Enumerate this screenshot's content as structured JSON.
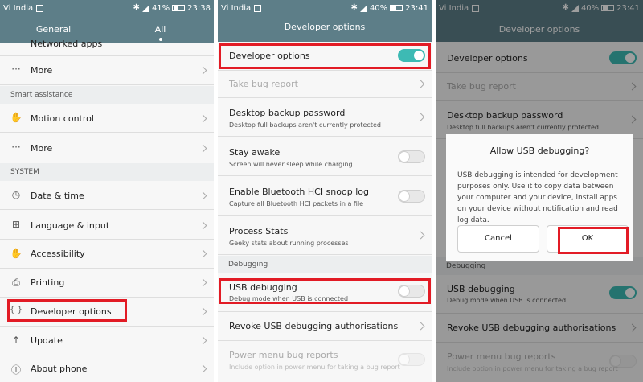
{
  "panel1": {
    "status": {
      "carrier": "Vi India",
      "battery": "41%",
      "time": "23:38"
    },
    "tabs": [
      {
        "label": "General"
      },
      {
        "label": "All"
      }
    ],
    "partial_row": "Networked apps",
    "rows_a": [
      {
        "label": "More"
      }
    ],
    "section_smart": "Smart assistance",
    "rows_b": [
      {
        "label": "Motion control",
        "icon": "✋"
      },
      {
        "label": "More",
        "icon": "···"
      }
    ],
    "section_system": "SYSTEM",
    "rows_c": [
      {
        "label": "Date & time",
        "icon": "◷"
      },
      {
        "label": "Language & input",
        "icon": "⊞"
      },
      {
        "label": "Accessibility",
        "icon": "✋"
      },
      {
        "label": "Printing",
        "icon": "⎙"
      },
      {
        "label": "Developer options",
        "icon": "{ }"
      },
      {
        "label": "Update",
        "icon": "↑"
      },
      {
        "label": "About phone",
        "icon": "ⓘ"
      }
    ]
  },
  "panel2": {
    "status": {
      "carrier": "Vi India",
      "battery": "40%",
      "time": "23:41"
    },
    "title": "Developer options",
    "rows": [
      {
        "label": "Developer options",
        "toggle": "on"
      },
      {
        "label": "Take bug report",
        "disabled": true
      },
      {
        "label": "Desktop backup password",
        "sub": "Desktop full backups aren't currently protected"
      },
      {
        "label": "Stay awake",
        "sub": "Screen will never sleep while charging",
        "toggle": "off"
      },
      {
        "label": "Enable Bluetooth HCI snoop log",
        "sub": "Capture all Bluetooth HCI packets in a file",
        "toggle": "off"
      },
      {
        "label": "Process Stats",
        "sub": "Geeky stats about running processes"
      },
      {
        "label": "USB debugging",
        "sub": "Debug mode when USB is connected",
        "toggle": "off"
      },
      {
        "label": "Revoke USB debugging authorisations"
      },
      {
        "label": "Power menu bug reports",
        "sub": "Include option in power menu for taking a bug report",
        "disabled": true,
        "toggle": "off"
      }
    ],
    "section_debugging": "Debugging"
  },
  "panel3": {
    "status": {
      "carrier": "Vi India",
      "battery": "40%",
      "time": "23:41"
    },
    "title": "Developer options",
    "rows": [
      {
        "label": "Developer options"
      },
      {
        "label": "Take bug report"
      },
      {
        "label": "Desktop backup password",
        "sub": "Desktop full backups aren't currently protected"
      },
      {
        "label": "Debugging"
      },
      {
        "label": "USB debugging",
        "sub": "Debug mode when USB is connected"
      },
      {
        "label": "Revoke USB debugging authorisations"
      },
      {
        "label": "Power menu bug reports",
        "sub": "Include option in power menu for taking a bug report"
      }
    ],
    "dialog": {
      "title": "Allow USB debugging?",
      "body": "USB debugging is intended for development purposes only. Use it to copy data between your computer and your device, install apps on your device without notification and read log data.",
      "cancel": "Cancel",
      "ok": "OK"
    }
  },
  "colors": {
    "appbar": "#5d7e88",
    "toggle_on": "#3dbab4",
    "highlight": "#e21b25"
  }
}
